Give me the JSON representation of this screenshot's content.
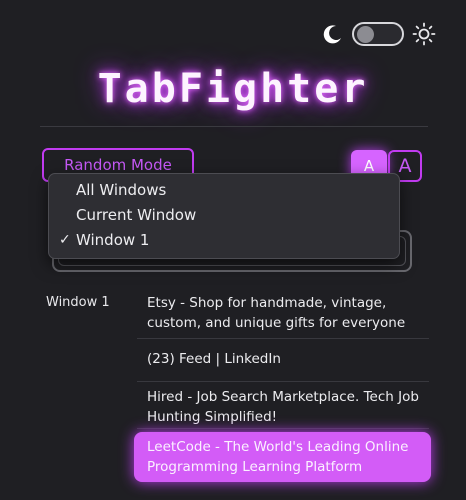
{
  "app": {
    "title": "TabFighter"
  },
  "theme": {
    "dark_icon": "moon-icon",
    "light_icon": "sun-icon",
    "mode": "dark"
  },
  "controls": {
    "random_mode_label": "Random Mode",
    "font_small_label": "A",
    "font_large_label": "A"
  },
  "window_menu": {
    "items": [
      {
        "label": "All Windows",
        "checked": false
      },
      {
        "label": "Current Window",
        "checked": false
      },
      {
        "label": "Window 1",
        "checked": true
      }
    ],
    "check_glyph": "✓"
  },
  "tab_list": {
    "window_label": "Window 1",
    "tabs": [
      {
        "title": "Etsy - Shop for handmade, vintage, custom, and unique gifts for everyone",
        "active": false
      },
      {
        "title": "(23) Feed | LinkedIn",
        "active": false
      },
      {
        "title": "Hired - Job Search Marketplace. Tech Job Hunting Simplified!",
        "active": false
      },
      {
        "title": "LeetCode - The World's Leading Online Programming Learning Platform",
        "active": true
      }
    ]
  },
  "colors": {
    "accent": "#c13bf0",
    "highlight": "#d35cf7",
    "background": "#1f1f23"
  }
}
